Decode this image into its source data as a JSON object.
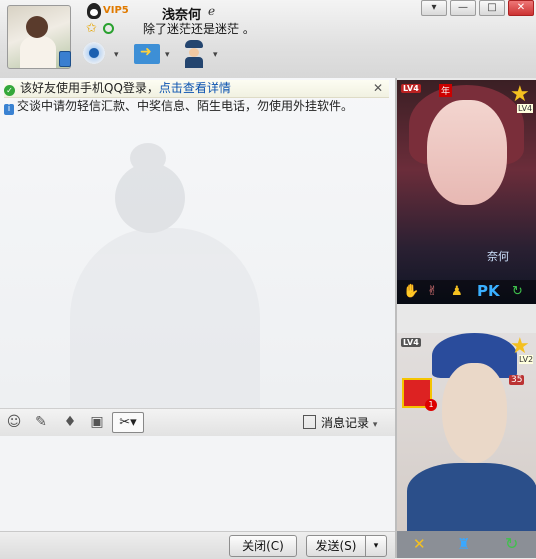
{
  "header": {
    "vip_label": "VIP5",
    "nickname": "浅奈何",
    "nickname_mark": "ℯ",
    "signature": "除了迷茫还是迷茫 。",
    "window_buttons": [
      "▾",
      "—",
      "□",
      "✕"
    ]
  },
  "notices": {
    "login_notice": "该好友使用手机QQ登录，",
    "login_link": "点击查看详情",
    "close_symbol": "✕",
    "safety_notice": "交谈中请勿轻信汇款、中奖信息、陌生电话，勿使用外挂软件。"
  },
  "input_toolbar": {
    "history_label": "消息记录",
    "history_arrow": "▾"
  },
  "bottom_bar": {
    "close_label": "关闭(C)",
    "send_label": "发送(S)",
    "send_dropdown": "▾"
  },
  "show1": {
    "level_tag": "LV4",
    "year_tag": "年",
    "level_tag_right": "LV4",
    "name_text": "奈何",
    "pk_label": "PK"
  },
  "show2": {
    "level_tag": "LV4",
    "level_tag_right": "LV2",
    "gift_count": "1",
    "volume_value": "35"
  },
  "colors": {
    "link": "#0b53b0",
    "vip": "#e07a00",
    "ok_green": "#34a83a",
    "info_blue": "#3a82d2"
  },
  "icons": [
    "qq-penguin-icon",
    "star-icon",
    "green-status-icon",
    "webcam-icon",
    "file-transfer-icon",
    "agent-icon",
    "phone-online-icon",
    "emoji-icon",
    "edit-icon",
    "mic-icon",
    "image-icon",
    "scissors-icon",
    "history-icon"
  ]
}
